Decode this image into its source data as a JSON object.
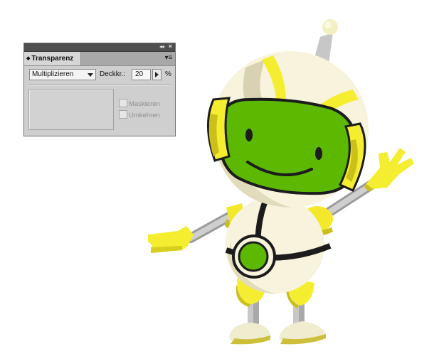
{
  "panel": {
    "tab_label": "Transparenz",
    "blend_mode": "Multiplizieren",
    "opacity_label": "Deckkr.:",
    "opacity_value": "20",
    "percent_sign": "%",
    "mask_label": "Maskieren",
    "invert_label": "Umkehren"
  },
  "colors": {
    "panel_bg": "#cfcfcf",
    "robot_green": "#5cb800",
    "robot_yellow": "#f5ee30",
    "robot_body": "#f7f3dc"
  }
}
